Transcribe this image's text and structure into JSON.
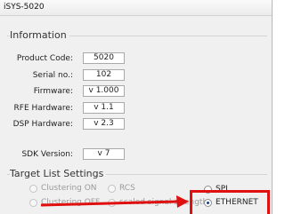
{
  "window": {
    "title": "iSYS-5020"
  },
  "info": {
    "title": "Information",
    "rows": [
      {
        "label": "Product Code:",
        "value": "5020"
      },
      {
        "label": "Serial no.:",
        "value": "102"
      },
      {
        "label": "Firmware:",
        "value": "v 1.000"
      },
      {
        "label": "RFE Hardware:",
        "value": "v 1.1"
      },
      {
        "label": "DSP Hardware:",
        "value": "v 2.3"
      }
    ],
    "sdk": {
      "label": "SDK Version:",
      "value": "v 7"
    }
  },
  "target_list": {
    "title": "Target List Settings",
    "clustering_on": "Clustering ON",
    "clustering_off": "Clustering OFF",
    "rcs": "RCS",
    "scaled": "scaled signal strength",
    "spi": "SPI",
    "ethernet": "ETHERNET"
  },
  "colors": {
    "highlight": "#e01010",
    "arrow": "#e01010"
  }
}
